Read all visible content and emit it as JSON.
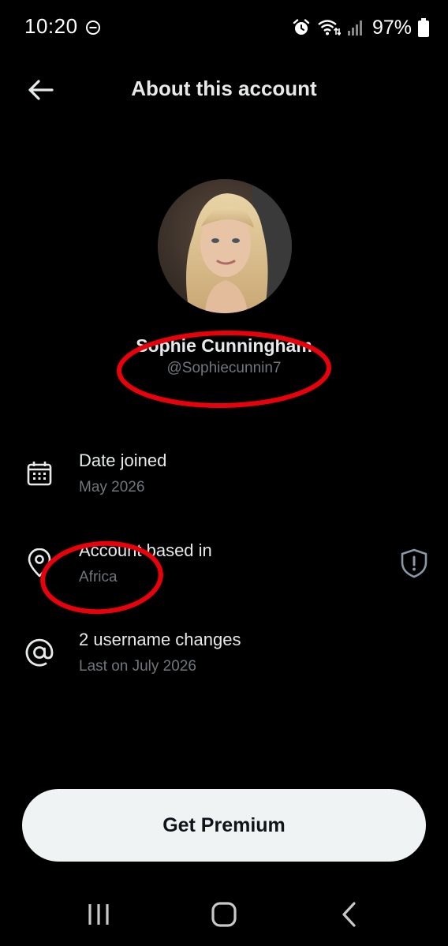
{
  "status_bar": {
    "time": "10:20",
    "battery": "97%",
    "icons": [
      "do-not-disturb-icon",
      "alarm-icon",
      "wifi-icon",
      "signal-icon",
      "battery-icon"
    ]
  },
  "header": {
    "title": "About this account",
    "back_icon": "back-arrow-icon"
  },
  "profile": {
    "name": "Sophie Cunningham",
    "handle": "@Sophiecunnin7"
  },
  "details": [
    {
      "icon": "calendar-icon",
      "title": "Date joined",
      "subtitle": "May 2026"
    },
    {
      "icon": "location-pin-icon",
      "title": "Account based in",
      "subtitle": "Africa",
      "trailing_icon": "shield-icon"
    },
    {
      "icon": "at-sign-icon",
      "title": "2 username changes",
      "subtitle": "Last on July 2026"
    }
  ],
  "premium_button": {
    "label": "Get Premium"
  },
  "nav_bar": {
    "icons": [
      "recent-apps-icon",
      "home-icon",
      "back-icon"
    ]
  },
  "colors": {
    "background": "#000000",
    "text_primary": "#e7e9ea",
    "text_secondary": "#71767b",
    "button_bg": "#eff3f4",
    "annotation": "#e8000b"
  }
}
